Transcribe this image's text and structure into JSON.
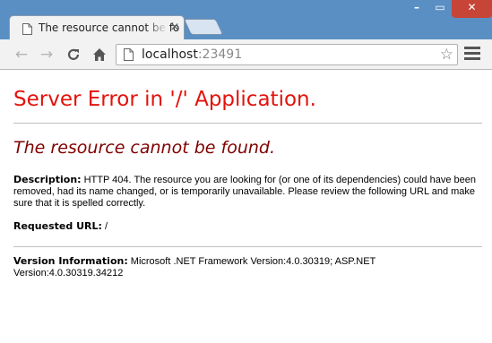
{
  "tab": {
    "title": "The resource cannot be fo"
  },
  "toolbar": {
    "url_host": "localhost",
    "url_port": ":23491"
  },
  "page": {
    "heading": "Server Error in '/' Application.",
    "subheading": "The resource cannot be found.",
    "description_label": "Description:",
    "description_text": " HTTP 404. The resource you are looking for (or one of its dependencies) could have been removed, had its name changed, or is temporarily unavailable.  Please review the following URL and make sure that it is spelled correctly.",
    "requested_url_label": "Requested URL:",
    "requested_url_value": " /",
    "version_label": "Version Information:",
    "version_text": " Microsoft .NET Framework Version:4.0.30319; ASP.NET Version:4.0.30319.34212"
  }
}
